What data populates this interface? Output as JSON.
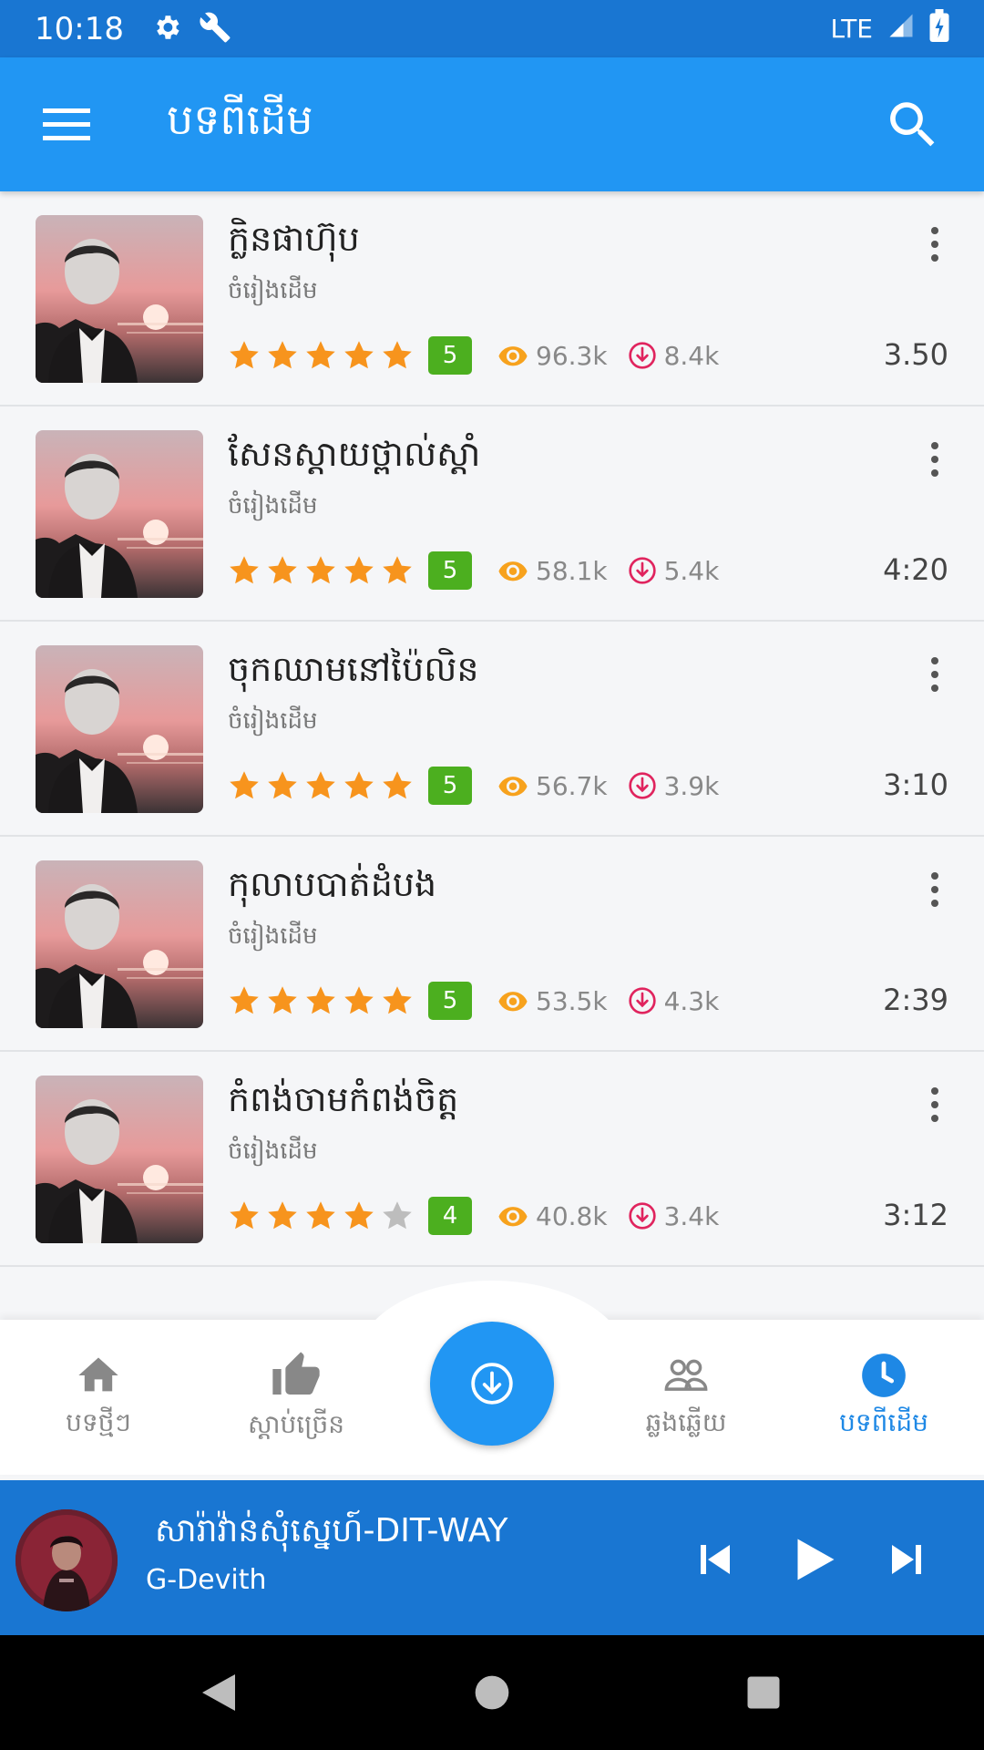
{
  "status_bar": {
    "time": "10:18",
    "network": "LTE"
  },
  "app_bar": {
    "title": "បទពីដើម"
  },
  "songs": [
    {
      "title": "ក្លិនផាហ៊ុប",
      "artist": "ចំរៀងដើម",
      "stars": 5,
      "rating": "5",
      "views": "96.3k",
      "downloads": "8.4k",
      "duration": "3.50"
    },
    {
      "title": "សែនស្តាយថ្ពាល់ស្តាំ",
      "artist": "ចំរៀងដើម",
      "stars": 5,
      "rating": "5",
      "views": "58.1k",
      "downloads": "5.4k",
      "duration": "4:20"
    },
    {
      "title": "ចុកឈាមនៅប៉ៃលិន",
      "artist": "ចំរៀងដើម",
      "stars": 5,
      "rating": "5",
      "views": "56.7k",
      "downloads": "3.9k",
      "duration": "3:10"
    },
    {
      "title": "កុលាបបាត់ដំបង",
      "artist": "ចំរៀងដើម",
      "stars": 5,
      "rating": "5",
      "views": "53.5k",
      "downloads": "4.3k",
      "duration": "2:39"
    },
    {
      "title": "កំពង់ចាមកំពង់ចិត្ត",
      "artist": "ចំរៀងដើម",
      "stars": 4,
      "rating": "4",
      "views": "40.8k",
      "downloads": "3.4k",
      "duration": "3:12"
    }
  ],
  "bottom_nav": {
    "items": [
      {
        "label": "បទថ្មីៗ",
        "icon": "home-icon"
      },
      {
        "label": "ស្តាប់ច្រើន",
        "icon": "thumb-up-icon"
      },
      {
        "label": "ឆ្លងឆ្លើយ",
        "icon": "people-icon"
      },
      {
        "label": "បទពីដើម",
        "icon": "clock-icon",
        "active": true
      }
    ]
  },
  "player": {
    "title": "សារ៉ាវ៉ាន់សុំស្នេហ៍-DIT-WAY",
    "artist": "G-Devith"
  },
  "colors": {
    "primary": "#2196f3",
    "primary_dark": "#1976d2",
    "star": "#f7941d",
    "rating_badge": "#4caf1f",
    "download_icon": "#e0245e",
    "eye_icon": "#f7a21d"
  }
}
